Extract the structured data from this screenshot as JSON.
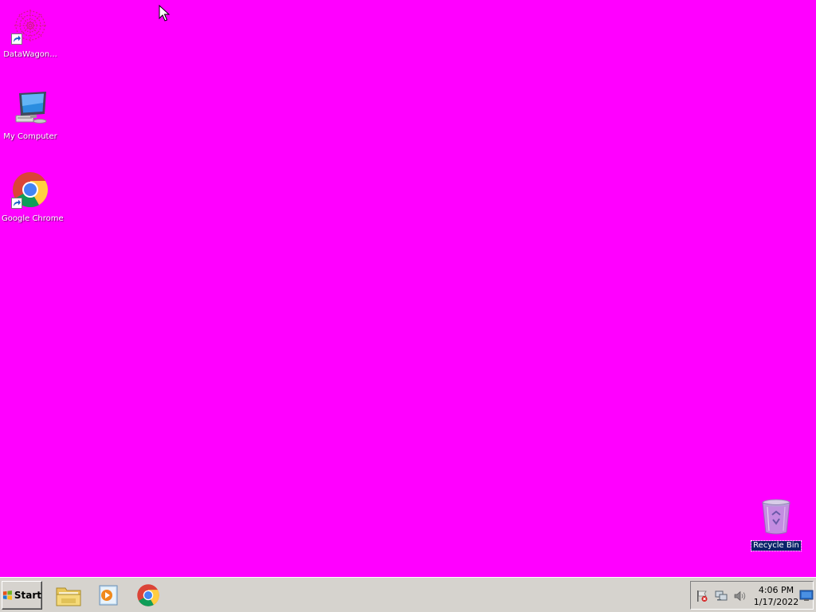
{
  "desktop": {
    "background_color": "#ff00ff",
    "icons": [
      {
        "label": "DataWagon...",
        "icon": "datawagon-icon",
        "shortcut": true
      },
      {
        "label": "My Computer",
        "icon": "computer-icon",
        "shortcut": false
      },
      {
        "label": "Google Chrome",
        "icon": "chrome-icon",
        "shortcut": true
      },
      {
        "label": "Recycle Bin",
        "icon": "recycle-bin-icon",
        "shortcut": false,
        "selected": true
      }
    ]
  },
  "taskbar": {
    "start_label": "Start",
    "pinned": [
      {
        "icon": "file-explorer-icon"
      },
      {
        "icon": "media-player-icon"
      },
      {
        "icon": "chrome-icon"
      }
    ],
    "tray": {
      "icons": [
        "action-center-flag-icon",
        "network-icon",
        "volume-icon"
      ],
      "time": "4:06 PM",
      "date": "1/17/2022"
    }
  }
}
